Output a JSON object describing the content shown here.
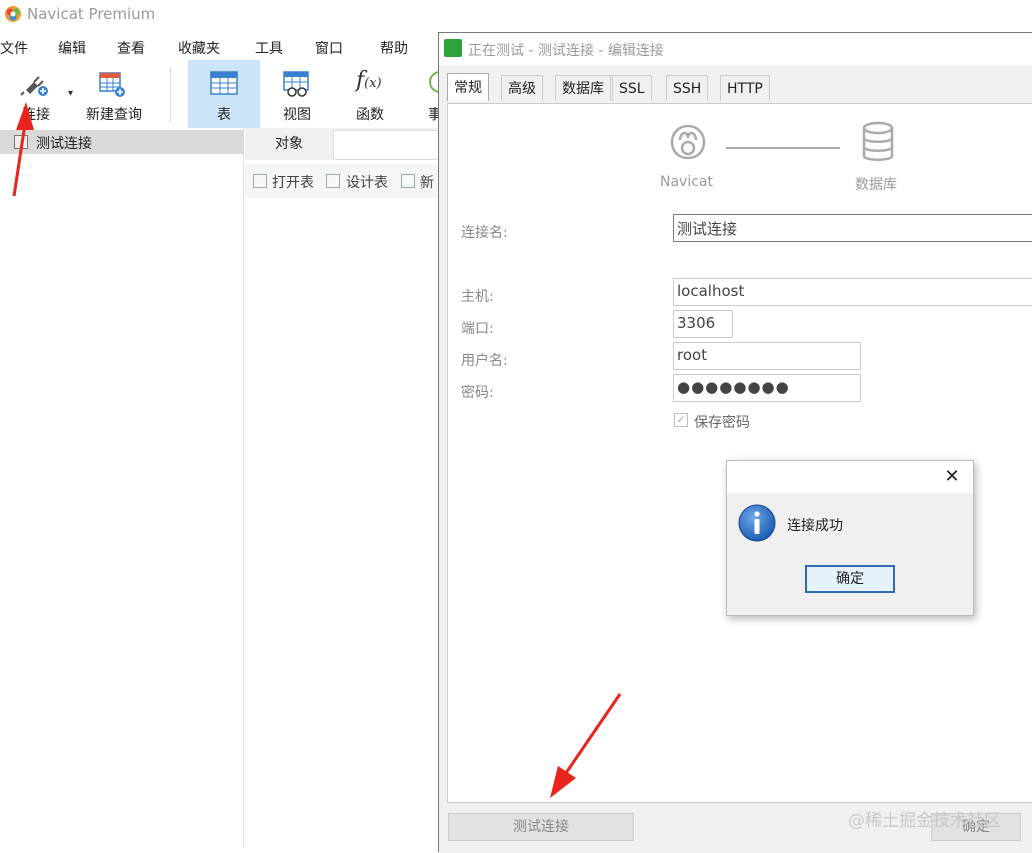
{
  "app": {
    "title": "Navicat Premium"
  },
  "menu": [
    "文件",
    "编辑",
    "查看",
    "收藏夹",
    "工具",
    "窗口",
    "帮助"
  ],
  "toolbar": {
    "connect": "连接",
    "new_query": "新建查询",
    "table": "表",
    "view": "视图",
    "function": "函数",
    "event_partial": "事"
  },
  "sidebar": {
    "connection_name": "测试连接"
  },
  "object_tab": {
    "label": "对象"
  },
  "object_toolbar": {
    "open_table": "打开表",
    "design_table": "设计表",
    "new_partial": "新"
  },
  "dialog": {
    "title": "正在测试 - 测试连接 - 编辑连接",
    "tabs": [
      "常规",
      "高级",
      "数据库",
      "SSL",
      "SSH",
      "HTTP"
    ],
    "diagram": {
      "left_label": "Navicat",
      "right_label": "数据库"
    },
    "fields": {
      "connection_name_label": "连接名:",
      "connection_name_value": "测试连接",
      "host_label": "主机:",
      "host_value": "localhost",
      "port_label": "端口:",
      "port_value": "3306",
      "user_label": "用户名:",
      "user_value": "root",
      "password_label": "密码:",
      "password_value": "●●●●●●●●",
      "save_password_label": "保存密码",
      "save_password_checked": true
    },
    "buttons": {
      "test_connection": "测试连接",
      "ok": "确定"
    }
  },
  "message_box": {
    "text": "连接成功",
    "ok": "确定",
    "close_glyph": "✕"
  },
  "watermark": "@稀土掘金技术社区",
  "colors": {
    "annotation_arrow": "#e8241c",
    "active_tool": "#cce4f7",
    "ok_border": "#2f6cb5",
    "info_blue": "#1c5db3"
  }
}
